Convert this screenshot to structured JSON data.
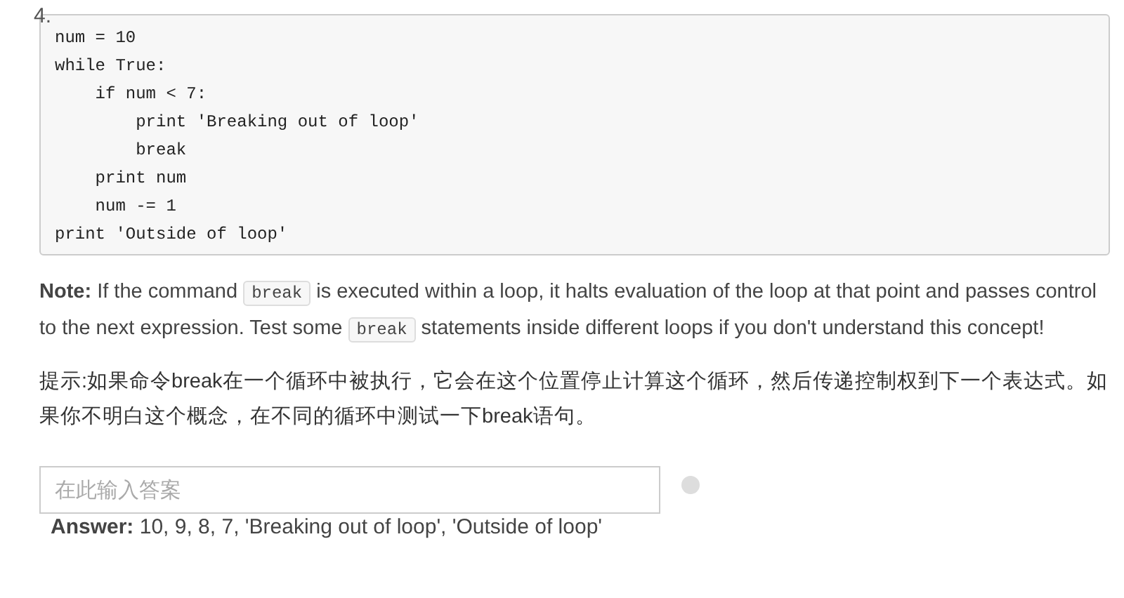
{
  "exercise_number": "4.",
  "code_lines": [
    "num = 10",
    "while True:",
    "    if num < 7:",
    "        print 'Breaking out of loop'",
    "        break",
    "    print num",
    "    num -= 1",
    "print 'Outside of loop'"
  ],
  "note": [
    {
      "kind": "text",
      "text": "**Note:** If the command "
    },
    {
      "kind": "code",
      "text": "break"
    },
    {
      "kind": "text",
      "text": " is executed within a loop, it halts evaluation of the loop at that point and passes control to the next expression. Test some "
    },
    {
      "kind": "code",
      "text": "break"
    },
    {
      "kind": "text",
      "text": " statements inside different loops if you don't understand this concept!"
    }
  ],
  "hint": "提示:如果命令break在一个循环中被执行，它会在这个位置停止计算这个循环，然后传递控制权到下一个表达式。如果你不明白这个概念，在不同的循环中测试一下break语句。",
  "answer_field": {
    "placeholder": "在此输入答案"
  },
  "answer": "**Answer:** 10, 9, 8, 7, 'Breaking out of loop', 'Outside of loop'"
}
